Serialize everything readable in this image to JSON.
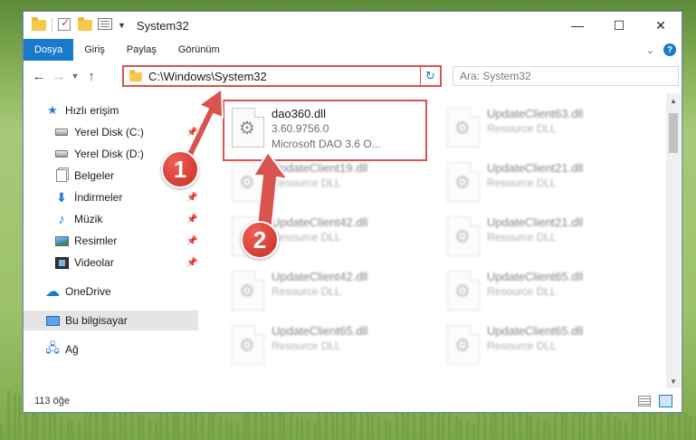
{
  "window": {
    "title": "System32",
    "controls": {
      "minimize": "—",
      "maximize": "☐",
      "close": "✕"
    }
  },
  "ribbon": {
    "tabs": [
      {
        "label": "Dosya",
        "active": true
      },
      {
        "label": "Giriş"
      },
      {
        "label": "Paylaş"
      },
      {
        "label": "Görünüm"
      }
    ]
  },
  "nav": {
    "address": "C:\\Windows\\System32",
    "search_placeholder": "Ara: System32"
  },
  "sidebar": {
    "items": [
      {
        "label": "Hızlı erişim",
        "icon": "star-icon"
      },
      {
        "label": "Yerel Disk (C:)",
        "icon": "drive-icon",
        "pinned": true
      },
      {
        "label": "Yerel Disk (D:)",
        "icon": "drive-icon"
      },
      {
        "label": "Belgeler",
        "icon": "documents-icon"
      },
      {
        "label": "İndirmeler",
        "icon": "download-icon",
        "pinned": true
      },
      {
        "label": "Müzik",
        "icon": "music-icon",
        "pinned": true
      },
      {
        "label": "Resimler",
        "icon": "pictures-icon",
        "pinned": true
      },
      {
        "label": "Videolar",
        "icon": "videos-icon",
        "pinned": true
      },
      {
        "label": "OneDrive",
        "icon": "cloud-icon"
      },
      {
        "label": "Bu bilgisayar",
        "icon": "computer-icon",
        "selected": true
      },
      {
        "label": "Ağ",
        "icon": "network-icon"
      }
    ]
  },
  "files": {
    "highlighted": {
      "name": "dao360.dll",
      "version": "3.60.9756.0",
      "description": "Microsoft DAO 3.6 O..."
    },
    "blurred": [
      {
        "name": "UpdateClient63.dll",
        "sub": "Resource DLL"
      },
      {
        "name": "UpdateClient19.dll",
        "sub": "Resource DLL"
      },
      {
        "name": "UpdateClient21.dll",
        "sub": "Resource DLL"
      },
      {
        "name": "UpdateClient42.dll",
        "sub": "Resource DLL"
      },
      {
        "name": "UpdateClient21.dll",
        "sub": "Resource DLL"
      },
      {
        "name": "UpdateClient42.dll",
        "sub": "Resource DLL"
      },
      {
        "name": "UpdateClient65.dll",
        "sub": "Resource DLL"
      },
      {
        "name": "UpdateClient65.dll",
        "sub": "Resource DLL"
      },
      {
        "name": "UpdateClient65.dll",
        "sub": "Resource DLL"
      }
    ]
  },
  "status": {
    "item_count": "113 öğe"
  },
  "annotations": {
    "badge1": "1",
    "badge2": "2",
    "color": "#d9534f"
  }
}
